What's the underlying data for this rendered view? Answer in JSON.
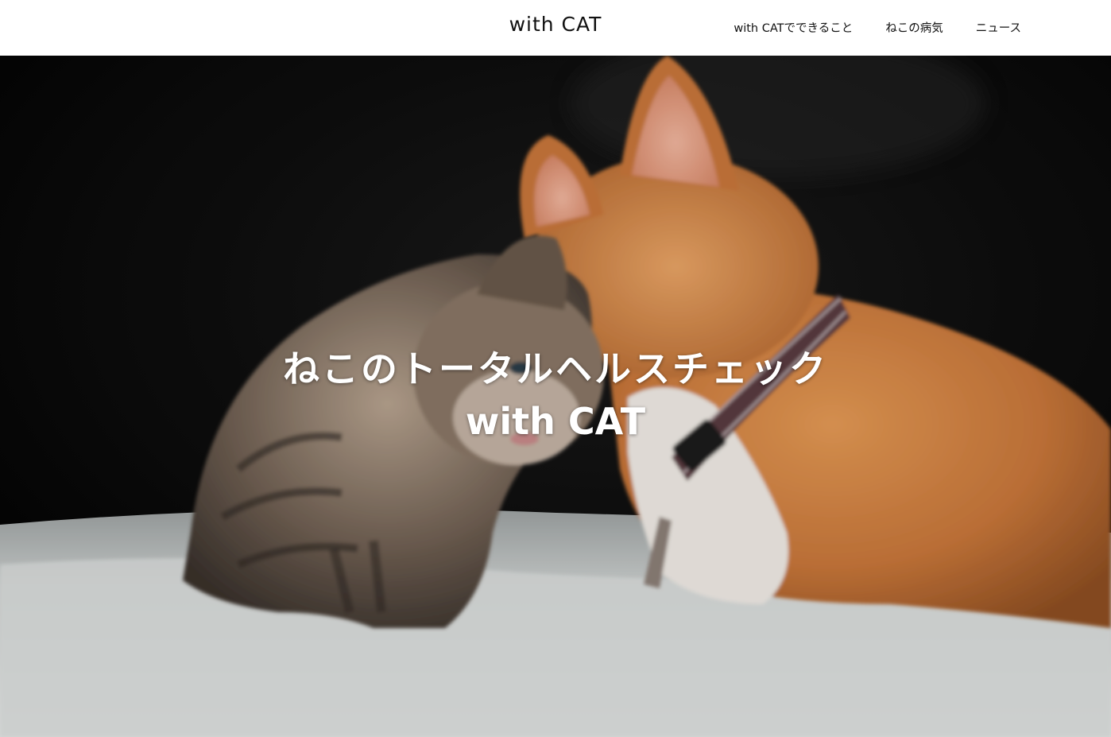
{
  "header": {
    "logo": "with CAT",
    "nav": [
      {
        "label": "with CATでできること"
      },
      {
        "label": "ねこの病気"
      },
      {
        "label": "ニュース"
      }
    ]
  },
  "hero": {
    "title_line1": "ねこのトータルヘルスチェック",
    "title_line2": "with CAT",
    "image_subject": "cats-photo",
    "text_color": "#ffffff"
  },
  "colors": {
    "header_bg": "#ffffff",
    "header_text": "#111111"
  }
}
